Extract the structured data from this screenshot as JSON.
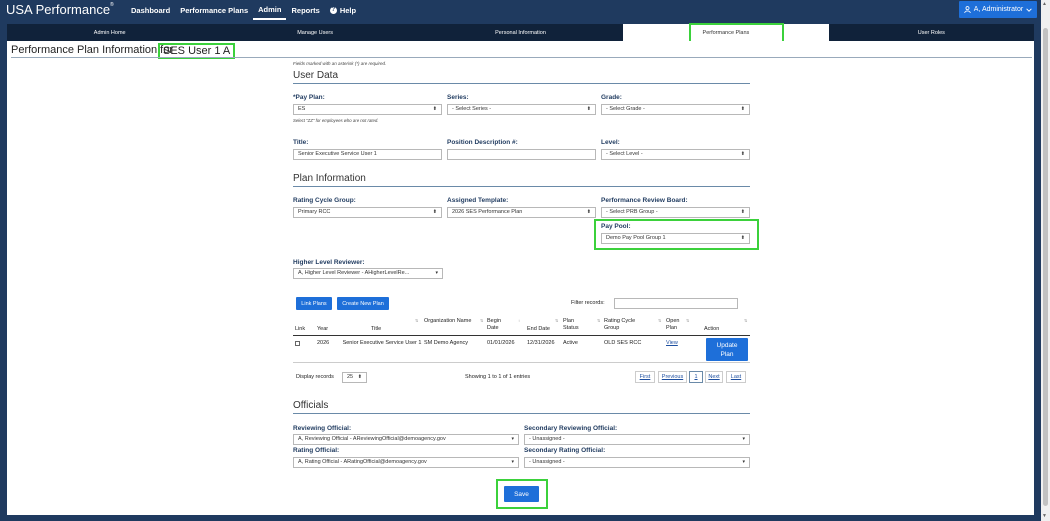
{
  "nav": {
    "brand": "USA Performance",
    "brand_mark": "®",
    "links": [
      "Dashboard",
      "Performance Plans",
      "Admin",
      "Reports",
      "Help"
    ],
    "user_label": "A, Administrator"
  },
  "subtabs": [
    "Admin Home",
    "Manage Users",
    "Personal Information",
    "Performance Plans",
    "User Roles"
  ],
  "page": {
    "title": "Performance Plan Information for",
    "user_name": "SES User 1 A",
    "required_note": "Fields marked with an asterisk (*) are required."
  },
  "user_data": {
    "heading": "User Data",
    "pay_plan_label": "*Pay Plan:",
    "pay_plan_value": "ES",
    "pay_plan_hint": "Select \"ZZ\" for employees who are not rated.",
    "series_label": "Series:",
    "series_value": "- Select Series -",
    "grade_label": "Grade:",
    "grade_value": "- Select Grade -",
    "title_label": "Title:",
    "title_value": "Senior Executive Service User 1",
    "pd_label": "Position Description #:",
    "pd_value": "",
    "level_label": "Level:",
    "level_value": "- Select Level -"
  },
  "plan_info": {
    "heading": "Plan Information",
    "rcg_label": "Rating Cycle Group:",
    "rcg_value": "Primary RCC",
    "template_label": "Assigned Template:",
    "template_value": "2026 SES Performance Plan",
    "prb_label": "Performance Review Board:",
    "prb_value": "- Select PRB Group -",
    "pay_pool_label": "Pay Pool:",
    "pay_pool_value": "Demo Pay Pool Group 1",
    "hlr_label": "Higher Level Reviewer:",
    "hlr_value": "A, Higher Level Reviewer - AHigherLevelRe..."
  },
  "plans_table": {
    "link_plans": "Link Plans",
    "create_plan": "Create New Plan",
    "filter_label": "Filter records:",
    "columns": [
      "Link",
      "Year",
      "Title",
      "Organization Name",
      "Begin Date",
      "End Date",
      "Plan Status",
      "Rating Cycle Group",
      "Open Plan",
      "Action"
    ],
    "rows": [
      {
        "year": "2026",
        "title": "Senior Executive Service User 1",
        "org": "SM Demo Agency",
        "begin": "01/01/2026",
        "end": "12/31/2026",
        "status": "Active",
        "rcg": "OLD SES RCC",
        "open": "View",
        "action": "Update Plan"
      }
    ],
    "display_label": "Display records",
    "display_value": "25",
    "showing": "Showing 1 to 1 of 1 entries",
    "pager": [
      "First",
      "Previous",
      "1",
      "Next",
      "Last"
    ]
  },
  "officials": {
    "heading": "Officials",
    "reviewing_label": "Reviewing Official:",
    "reviewing_value": "A, Reviewing Official - AReviewingOfficial@demoagency.gov",
    "sec_reviewing_label": "Secondary Reviewing Official:",
    "sec_reviewing_value": "- Unassigned -",
    "rating_label": "Rating Official:",
    "rating_value": "A, Rating Official - ARatingOfficial@demoagency.gov",
    "sec_rating_label": "Secondary Rating Official:",
    "sec_rating_value": "- Unassigned -"
  },
  "save_label": "Save",
  "colors": {
    "nav": "#1f3a5f",
    "accent": "#1e6fd9",
    "highlight": "#3bd13b"
  }
}
